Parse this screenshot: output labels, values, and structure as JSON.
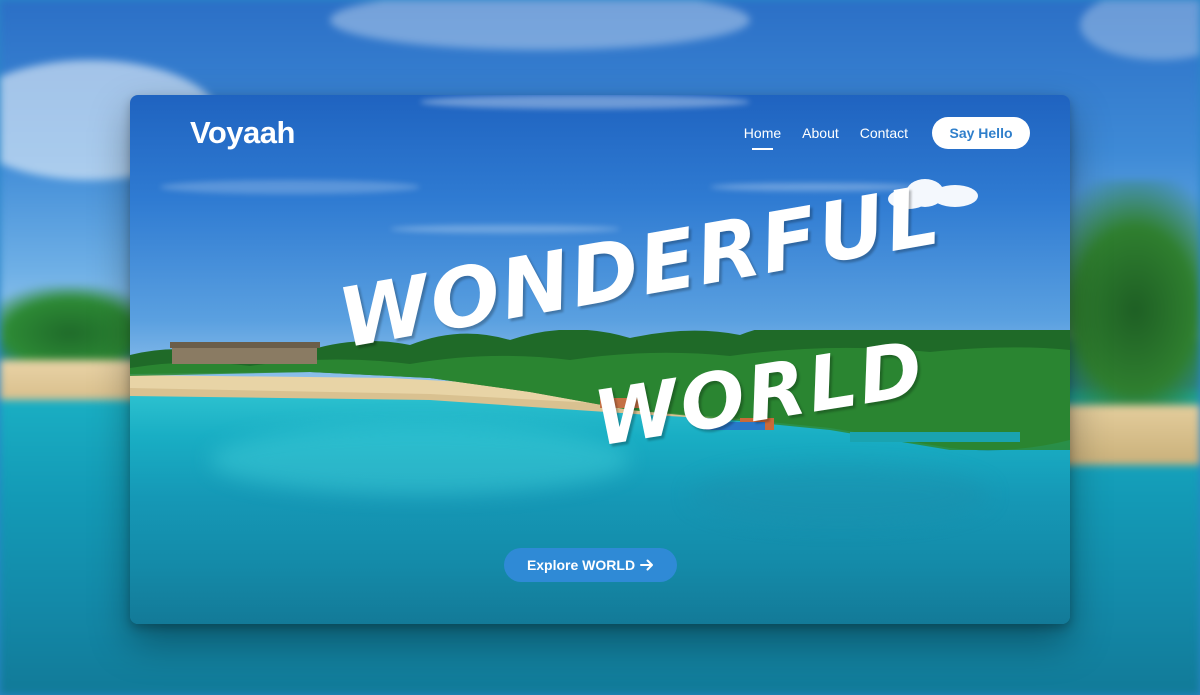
{
  "brand": {
    "name": "Voyaah"
  },
  "nav": {
    "items": [
      {
        "label": "Home"
      },
      {
        "label": "About"
      },
      {
        "label": "Contact"
      }
    ],
    "cta_label": "Say Hello"
  },
  "hero": {
    "line1": "WONDERFUL",
    "line2": "WORLD",
    "button_label": "Explore WORLD",
    "button_icon": "arrow-right-icon"
  },
  "colors": {
    "accent": "#2f8ad6",
    "cta_text": "#2f7fcb",
    "text_on_image": "#ffffff"
  }
}
